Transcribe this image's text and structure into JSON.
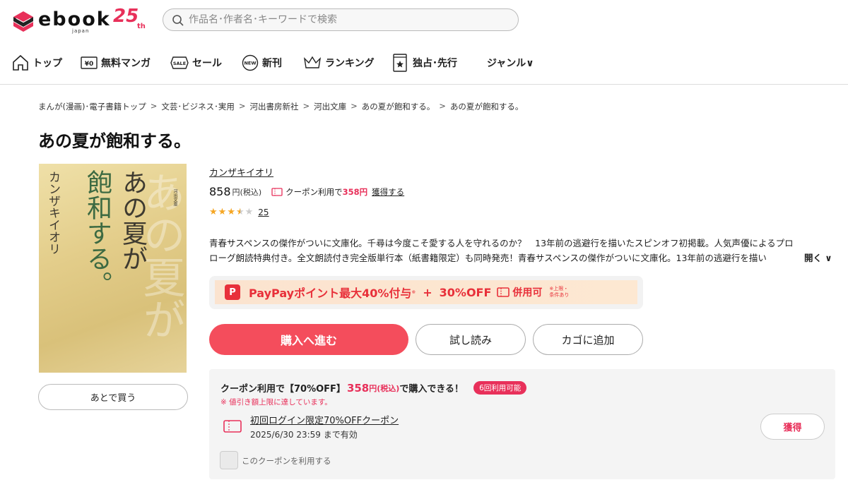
{
  "header": {
    "logo_text": "ebook",
    "logo_sub": "japan",
    "logo_anniv": "25",
    "logo_anniv_suffix": "th",
    "search_placeholder": "作品名･作者名･キーワードで検索"
  },
  "nav": {
    "items": [
      {
        "label": "トップ",
        "icon": "home-icon"
      },
      {
        "label": "無料マンガ",
        "icon": "free-yen-icon"
      },
      {
        "label": "セール",
        "icon": "sale-tag-icon"
      },
      {
        "label": "新刊",
        "icon": "new-badge-icon"
      },
      {
        "label": "ランキング",
        "icon": "crown-icon"
      },
      {
        "label": "独占･先行",
        "icon": "exclusive-book-icon"
      },
      {
        "label": "ジャンル∨",
        "icon": ""
      }
    ]
  },
  "breadcrumb": [
    "まんが(漫画)･電子書籍トップ",
    "文芸･ビジネス･実用",
    "河出書房新社",
    "河出文庫",
    "あの夏が飽和する。",
    "あの夏が飽和する。"
  ],
  "breadcrumb_sep": ">",
  "title": "あの夏が飽和する。",
  "cover": {
    "title_chars_1": "あの夏が",
    "title_chars_2": "飽和する。",
    "author_vertical": "カンザキイオリ",
    "publisher_small": "河出文庫"
  },
  "later_button": "あとで買う",
  "author": "カンザキイオリ",
  "price": {
    "value": "858",
    "unit": "円(税込)",
    "coupon_text": "クーポン利用で",
    "coupon_price": "358円",
    "coupon_link": "獲得する"
  },
  "rating": {
    "score": 3.5,
    "max": 5,
    "count": "25"
  },
  "description": {
    "line1": "青春サスペンスの傑作がついに文庫化。千尋は今度こそ愛する人を守れるのか？　13年前の逃避行を描いたスピンオフ初掲載。人気声優によるプロ",
    "line2": "ローグ朗読特典付き。全文朗読付き完全版単行本（紙書籍限定）も同時発売！青春サスペンスの傑作がついに文庫化。13年前の逃避行を描い",
    "expand": "開く ∨"
  },
  "paypay": {
    "logo": "P",
    "text": "PayPayポイント最大40%付与",
    "sup": "※",
    "plus": "+",
    "off": "30%OFF",
    "combo": "併用可",
    "note1": "※上限・",
    "note2": "条件あり"
  },
  "buttons": {
    "buy": "購入へ進む",
    "sample": "試し読み",
    "cart": "カゴに追加"
  },
  "coupon_box": {
    "head_text": "クーポン利用で【70%OFF】",
    "head_price": "358",
    "head_unit": "円(税込)",
    "head_tail": "で購入できる！",
    "badge": "6回利用可能",
    "warning": "※ 値引き額上限に達しています。",
    "coupon_name": "初回ログイン限定70%OFFクーポン",
    "expiry": "2025/6/30 23:59 まで有効",
    "get_button": "獲得",
    "checkbox_label": "このクーポンを利用する"
  },
  "colors": {
    "accent": "#f44d5c",
    "coupon_red": "#e8305a",
    "star": "#f5a623"
  }
}
